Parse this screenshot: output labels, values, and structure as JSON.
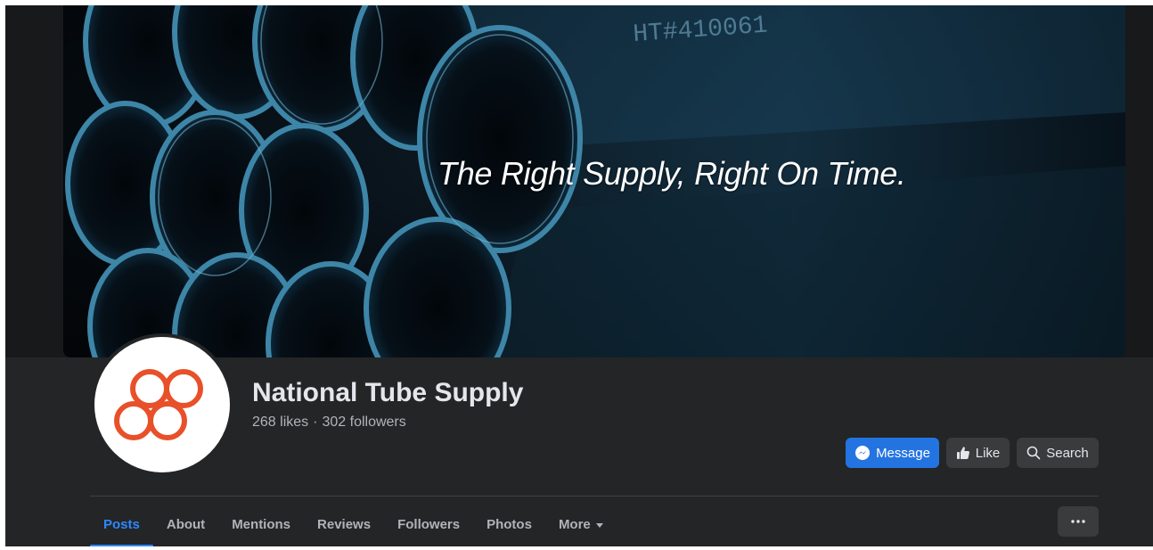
{
  "cover": {
    "tagline": "The Right Supply, Right On Time.",
    "pipe_marking": "HT#410061"
  },
  "page": {
    "name": "National Tube Supply",
    "likes": "268 likes",
    "separator": "·",
    "followers": "302 followers"
  },
  "actions": {
    "message_label": "Message",
    "like_label": "Like",
    "search_label": "Search",
    "more_icon": "ellipsis-icon"
  },
  "tabs": [
    {
      "label": "Posts",
      "active": true
    },
    {
      "label": "About",
      "active": false
    },
    {
      "label": "Mentions",
      "active": false
    },
    {
      "label": "Reviews",
      "active": false
    },
    {
      "label": "Followers",
      "active": false
    },
    {
      "label": "Photos",
      "active": false
    },
    {
      "label": "More",
      "active": false
    }
  ],
  "colors": {
    "background": "#242526",
    "accent": "#2d88ff",
    "message_button": "#2374e1",
    "logo": "#e8502a",
    "text_primary": "#e4e6eb",
    "text_secondary": "#b0b3b8"
  }
}
